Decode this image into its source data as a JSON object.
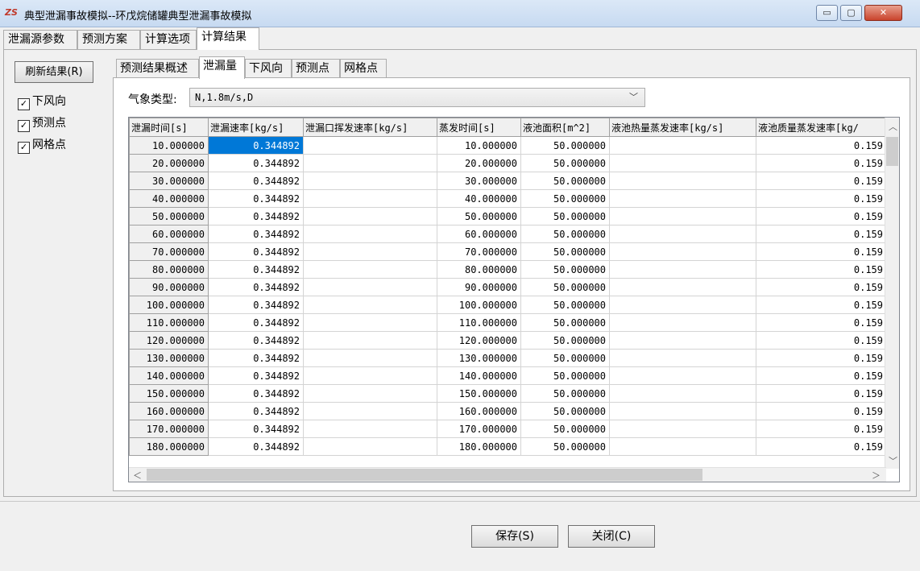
{
  "window": {
    "logo": "ZS",
    "title": "典型泄漏事故模拟--环戊烷储罐典型泄漏事故模拟",
    "controls": {
      "minimize": "▭",
      "maximize": "▢",
      "close": "✕"
    }
  },
  "outer_tabs": [
    "泄漏源参数",
    "预测方案",
    "计算选项",
    "计算结果"
  ],
  "refresh_button": "刷新结果(R)",
  "checkboxes": [
    {
      "label": "下风向",
      "checked": true
    },
    {
      "label": "预测点",
      "checked": true
    },
    {
      "label": "网格点",
      "checked": true
    }
  ],
  "inner_tabs": [
    "预测结果概述",
    "泄漏量",
    "下风向",
    "预测点",
    "网格点"
  ],
  "weather": {
    "label": "气象类型:",
    "value": "N,1.8m/s,D"
  },
  "table": {
    "headers": [
      "泄漏时间[s]",
      "泄漏速率[kg/s]",
      "泄漏口挥发速率[kg/s]",
      "蒸发时间[s]",
      "液池面积[m^2]",
      "液池热量蒸发速率[kg/s]",
      "液池质量蒸发速率[kg/"
    ],
    "rows": [
      [
        "10.000000",
        "0.344892",
        "",
        "10.000000",
        "50.000000",
        "",
        "0.159"
      ],
      [
        "20.000000",
        "0.344892",
        "",
        "20.000000",
        "50.000000",
        "",
        "0.159"
      ],
      [
        "30.000000",
        "0.344892",
        "",
        "30.000000",
        "50.000000",
        "",
        "0.159"
      ],
      [
        "40.000000",
        "0.344892",
        "",
        "40.000000",
        "50.000000",
        "",
        "0.159"
      ],
      [
        "50.000000",
        "0.344892",
        "",
        "50.000000",
        "50.000000",
        "",
        "0.159"
      ],
      [
        "60.000000",
        "0.344892",
        "",
        "60.000000",
        "50.000000",
        "",
        "0.159"
      ],
      [
        "70.000000",
        "0.344892",
        "",
        "70.000000",
        "50.000000",
        "",
        "0.159"
      ],
      [
        "80.000000",
        "0.344892",
        "",
        "80.000000",
        "50.000000",
        "",
        "0.159"
      ],
      [
        "90.000000",
        "0.344892",
        "",
        "90.000000",
        "50.000000",
        "",
        "0.159"
      ],
      [
        "100.000000",
        "0.344892",
        "",
        "100.000000",
        "50.000000",
        "",
        "0.159"
      ],
      [
        "110.000000",
        "0.344892",
        "",
        "110.000000",
        "50.000000",
        "",
        "0.159"
      ],
      [
        "120.000000",
        "0.344892",
        "",
        "120.000000",
        "50.000000",
        "",
        "0.159"
      ],
      [
        "130.000000",
        "0.344892",
        "",
        "130.000000",
        "50.000000",
        "",
        "0.159"
      ],
      [
        "140.000000",
        "0.344892",
        "",
        "140.000000",
        "50.000000",
        "",
        "0.159"
      ],
      [
        "150.000000",
        "0.344892",
        "",
        "150.000000",
        "50.000000",
        "",
        "0.159"
      ],
      [
        "160.000000",
        "0.344892",
        "",
        "160.000000",
        "50.000000",
        "",
        "0.159"
      ],
      [
        "170.000000",
        "0.344892",
        "",
        "170.000000",
        "50.000000",
        "",
        "0.159"
      ],
      [
        "180.000000",
        "0.344892",
        "",
        "180.000000",
        "50.000000",
        "",
        "0.159"
      ]
    ]
  },
  "buttons": {
    "save": "保存(S)",
    "close": "关闭(C)"
  },
  "colors": {
    "selection": "#0078d7",
    "titlebar": "#c7daf1",
    "close_button": "#c9432c"
  }
}
